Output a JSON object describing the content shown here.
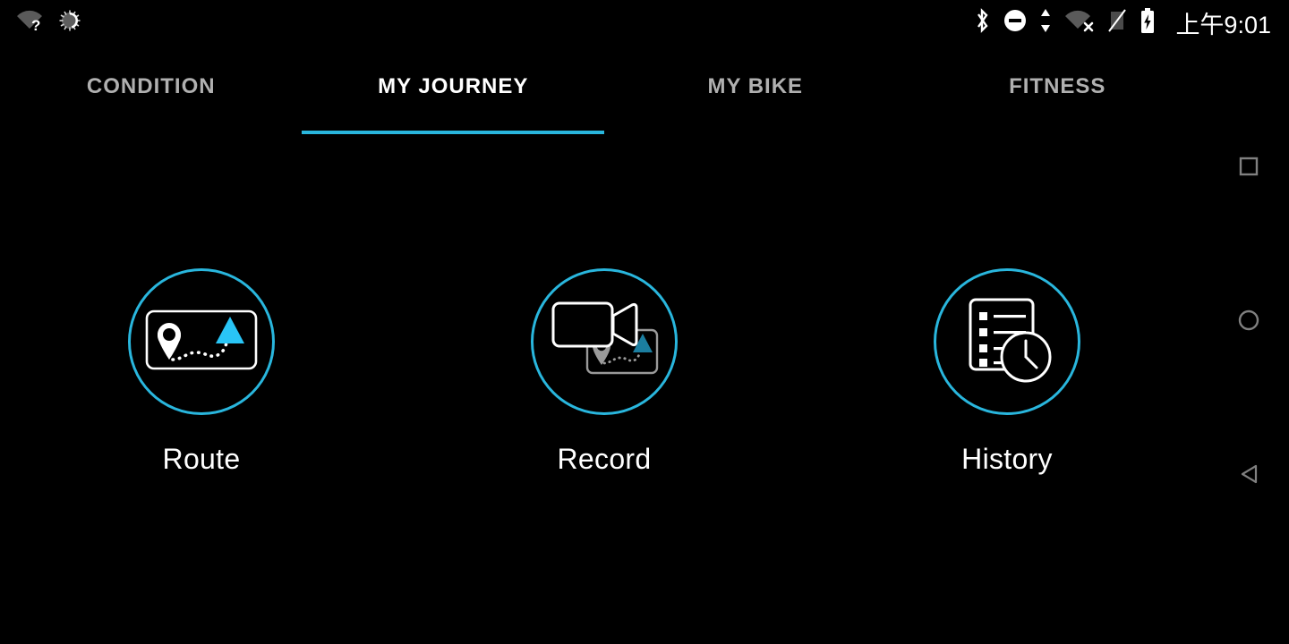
{
  "app": {
    "background_color": "#000000",
    "accent_color": "#29b6dd",
    "active_tab_text_color": "#ffffff",
    "inactive_tab_text_color": "#b0b0b0"
  },
  "statusbar": {
    "time": "上午9:01",
    "left_icons": [
      {
        "name": "wifi-unknown-icon",
        "glyph": "wifi-question"
      },
      {
        "name": "sync-spinner-icon",
        "glyph": "spinner"
      }
    ],
    "right_icons": [
      {
        "name": "bluetooth-icon",
        "glyph": "bluetooth"
      },
      {
        "name": "do-not-disturb-icon",
        "glyph": "minus-circle"
      },
      {
        "name": "data-transfer-icon",
        "glyph": "up-down-arrows"
      },
      {
        "name": "wifi-disconnected-icon",
        "glyph": "wifi-x"
      },
      {
        "name": "signal-off-icon",
        "glyph": "slashed-bars"
      },
      {
        "name": "battery-charging-icon",
        "glyph": "battery-bolt"
      }
    ]
  },
  "tabs": [
    {
      "label": "CONDITION",
      "active": false
    },
    {
      "label": "MY JOURNEY",
      "active": true
    },
    {
      "label": "MY BIKE",
      "active": false
    },
    {
      "label": "FITNESS",
      "active": false
    }
  ],
  "tiles": [
    {
      "label": "Route",
      "icon": "route-map-icon"
    },
    {
      "label": "Record",
      "icon": "record-video-map-icon"
    },
    {
      "label": "History",
      "icon": "history-list-clock-icon"
    }
  ],
  "navbar": {
    "buttons": [
      {
        "name": "recents-button",
        "glyph": "square"
      },
      {
        "name": "home-button",
        "glyph": "circle"
      },
      {
        "name": "back-button",
        "glyph": "triangle-left"
      }
    ]
  }
}
